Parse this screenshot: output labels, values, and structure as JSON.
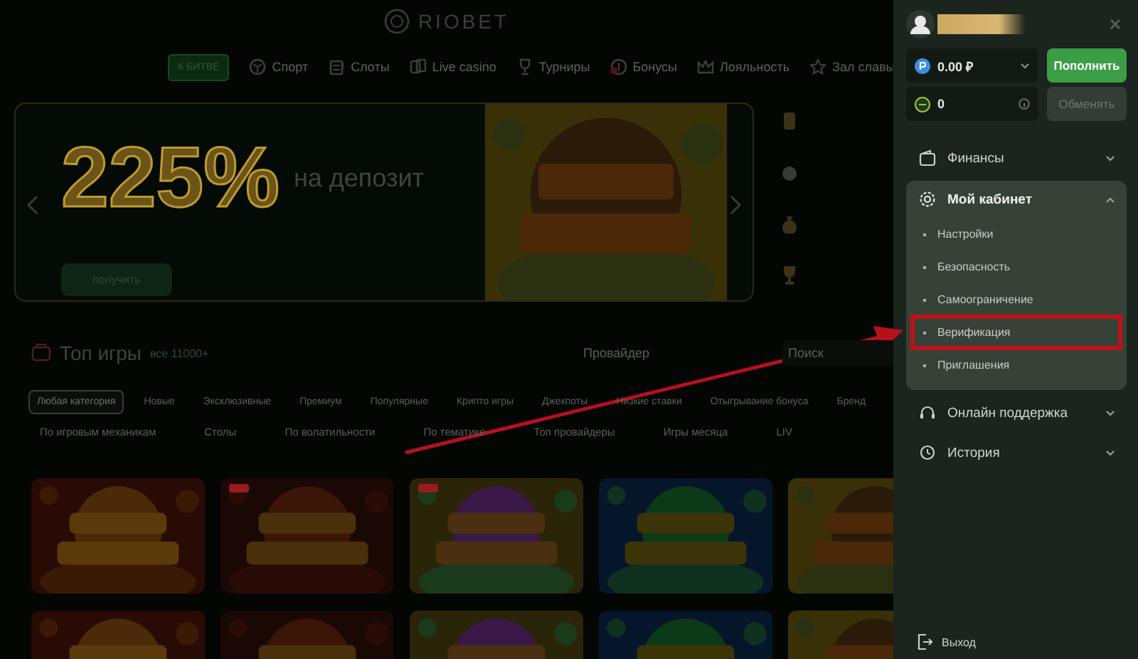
{
  "site": {
    "logo": "RIOBET",
    "nav": [
      {
        "label": "К БИТВЕ",
        "kind": "button",
        "badge": false
      },
      {
        "label": "Спорт",
        "kind": "link",
        "badge": false
      },
      {
        "label": "Слоты",
        "kind": "link",
        "badge": false
      },
      {
        "label": "Live casino",
        "kind": "link",
        "badge": false
      },
      {
        "label": "Турниры",
        "kind": "link",
        "badge": false
      },
      {
        "label": "Бонусы",
        "kind": "link",
        "badge": true
      },
      {
        "label": "Лояльность",
        "kind": "link",
        "badge": false
      },
      {
        "label": "Зал славы",
        "kind": "link",
        "badge": false
      }
    ],
    "banner": {
      "headline": "225%",
      "subline": "на депозит",
      "button": "получить"
    },
    "games": {
      "title": "Топ игры",
      "all_link": "все 11000+",
      "provider": {
        "placeholder": "Провайдер"
      },
      "search": {
        "placeholder": "Поиск"
      },
      "categories": [
        {
          "label": "Любая категория",
          "selected": true
        },
        {
          "label": "Новые",
          "selected": false
        },
        {
          "label": "Эксклюзивные",
          "selected": false
        },
        {
          "label": "Премиум",
          "selected": false
        },
        {
          "label": "Популярные",
          "selected": false
        },
        {
          "label": "Крипто игры",
          "selected": false
        },
        {
          "label": "Джекпоты",
          "selected": false
        },
        {
          "label": "Низкие ставки",
          "selected": false
        },
        {
          "label": "Отыгрывание бонуса",
          "selected": false
        },
        {
          "label": "Бренд",
          "selected": false
        }
      ],
      "filters": [
        "По игровым механикам",
        "Столы",
        "По волатильности",
        "По тематике",
        "Топ провайдеры",
        "Игры месяца",
        "LIV"
      ],
      "tiles": [
        {
          "kind": "picture",
          "new": false
        },
        {
          "kind": "picture",
          "new": true
        },
        {
          "kind": "picture",
          "new": true
        },
        {
          "kind": "picture",
          "new": false
        },
        {
          "kind": "picture",
          "new": false
        }
      ]
    }
  },
  "panel": {
    "balance": "0.00 ₽",
    "deposit_button": "Пополнить",
    "points": "0",
    "exchange_button": {
      "label": "Обменять",
      "disabled": true
    },
    "menu": [
      {
        "label": "Финансы",
        "expanded": false
      },
      {
        "label": "Мой кабинет",
        "expanded": true,
        "children": [
          {
            "label": "Настройки",
            "highlighted": false
          },
          {
            "label": "Безопасность",
            "highlighted": false
          },
          {
            "label": "Самоограничение",
            "highlighted": false
          },
          {
            "label": "Верификация",
            "highlighted": true
          },
          {
            "label": "Приглашения",
            "highlighted": false
          }
        ]
      },
      {
        "label": "Онлайн поддержка",
        "expanded": false
      },
      {
        "label": "История",
        "expanded": false
      }
    ],
    "logout": "Выход"
  }
}
